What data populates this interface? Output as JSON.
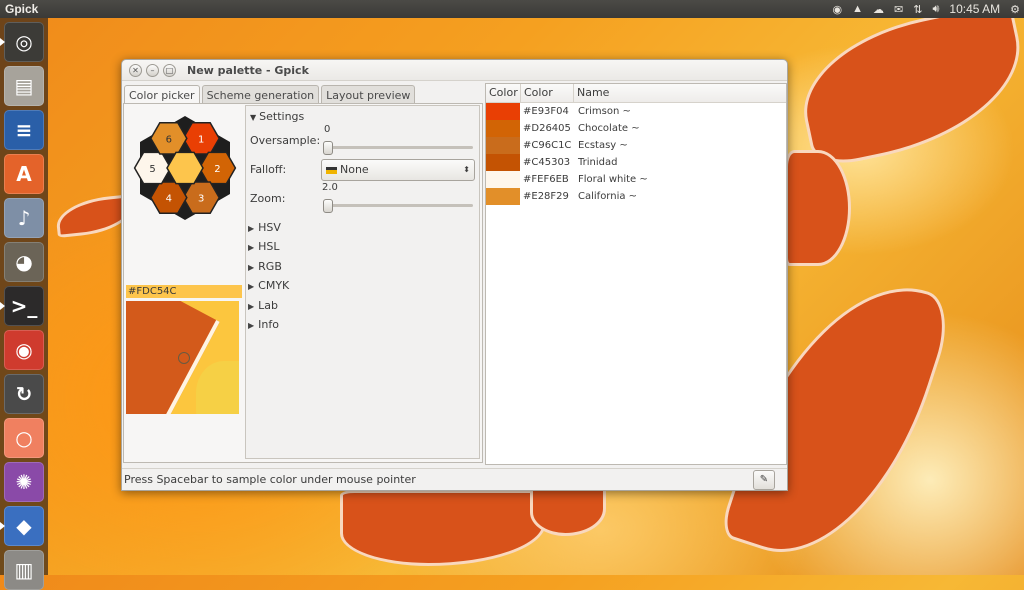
{
  "top_panel": {
    "app_name": "Gpick",
    "clock": "10:45 AM",
    "tray_icons": [
      "chrome-icon",
      "vlc-icon",
      "cloud-icon",
      "mail-icon",
      "network-icon",
      "volume-icon"
    ]
  },
  "launcher": {
    "items": [
      {
        "name": "ubuntu-dash-icon",
        "color": "#3c3b37",
        "glyph": "◎"
      },
      {
        "name": "files-icon",
        "color": "#a7a39b",
        "glyph": "▤"
      },
      {
        "name": "writer-icon",
        "color": "#2a5fa8",
        "glyph": "≡"
      },
      {
        "name": "software-center-icon",
        "color": "#e4632a",
        "glyph": "A"
      },
      {
        "name": "rhythmbox-icon",
        "color": "#7e8fa6",
        "glyph": "♪"
      },
      {
        "name": "gimp-icon",
        "color": "#6b6457",
        "glyph": "◕"
      },
      {
        "name": "terminal-icon",
        "color": "#2c2a2a",
        "glyph": ">_"
      },
      {
        "name": "chrome-icon",
        "color": "#cf3b2e",
        "glyph": "◉"
      },
      {
        "name": "update-manager-icon",
        "color": "#4a4a4a",
        "glyph": "↻"
      },
      {
        "name": "nautilus-extra-icon",
        "color": "#f08060",
        "glyph": "○"
      },
      {
        "name": "color-wheel-icon",
        "color": "#8a4aa8",
        "glyph": "✺"
      },
      {
        "name": "gpick-icon",
        "color": "#3a6fc0",
        "glyph": "◆"
      },
      {
        "name": "trash-icon",
        "color": "#8c8a86",
        "glyph": "▥"
      }
    ]
  },
  "window": {
    "title": "New palette - Gpick",
    "tabs": [
      "Color picker",
      "Scheme generation",
      "Layout preview"
    ],
    "active_tab": "Color picker",
    "swatches": [
      {
        "num": "1",
        "color": "#e93f04",
        "text": "#ffffff"
      },
      {
        "num": "2",
        "color": "#d26405",
        "text": "#ffffff"
      },
      {
        "num": "3",
        "color": "#c96c1c",
        "text": "#ffffff"
      },
      {
        "num": "4",
        "color": "#c45303",
        "text": "#ffffff"
      },
      {
        "num": "5",
        "color": "#fef6eb",
        "text": "#333333"
      },
      {
        "num": "6",
        "color": "#e28f29",
        "text": "#333333"
      },
      {
        "num": "",
        "color": "#fdc54c",
        "text": "#333333"
      }
    ],
    "current_hex": "#FDC54C",
    "settings": {
      "header": "Settings",
      "oversample_label": "Oversample:",
      "oversample_value": "0",
      "falloff_label": "Falloff:",
      "falloff_value": "None",
      "zoom_label": "Zoom:",
      "zoom_value": "2.0"
    },
    "expanders": [
      "HSV",
      "HSL",
      "RGB",
      "CMYK",
      "Lab",
      "Info"
    ],
    "list": {
      "headers": [
        "Color",
        "Color",
        "Name"
      ],
      "rows": [
        {
          "swatch": "#e93f04",
          "hex": "#E93F04",
          "name": "Crimson ~"
        },
        {
          "swatch": "#d26405",
          "hex": "#D26405",
          "name": "Chocolate ~"
        },
        {
          "swatch": "#c96c1c",
          "hex": "#C96C1C",
          "name": "Ecstasy ~"
        },
        {
          "swatch": "#c45303",
          "hex": "#C45303",
          "name": "Trinidad"
        },
        {
          "swatch": "#fef6eb",
          "hex": "#FEF6EB",
          "name": "Floral white ~"
        },
        {
          "swatch": "#e28f29",
          "hex": "#E28F29",
          "name": "California ~"
        }
      ]
    },
    "status_text": "Press Spacebar to sample color under mouse pointer"
  }
}
